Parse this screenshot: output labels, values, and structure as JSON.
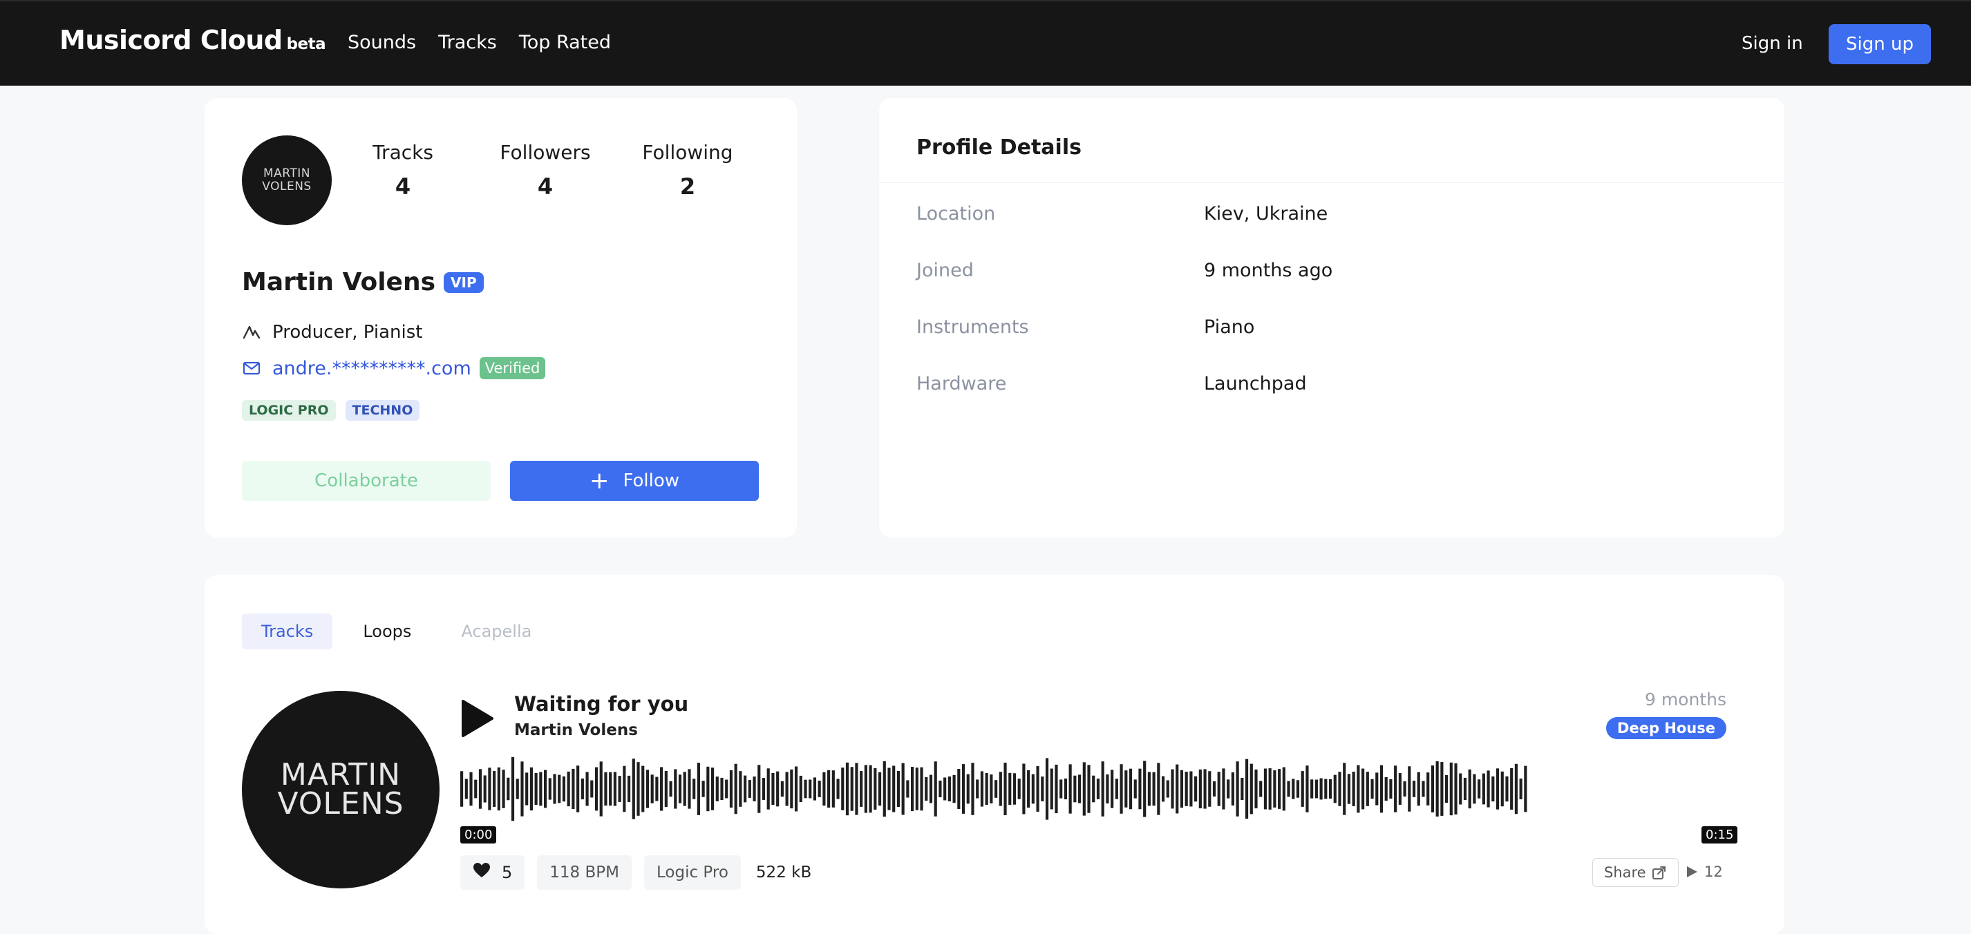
{
  "navbar": {
    "brand": "Musicord Cloud",
    "beta": "beta",
    "links": [
      "Sounds",
      "Tracks",
      "Top Rated"
    ],
    "sign_in": "Sign in",
    "sign_up": "Sign up"
  },
  "profile": {
    "avatar_line1": "MARTIN",
    "avatar_line2": "VOLENS",
    "stats": [
      {
        "label": "Tracks",
        "value": "4"
      },
      {
        "label": "Followers",
        "value": "4"
      },
      {
        "label": "Following",
        "value": "2"
      }
    ],
    "name": "Martin Volens",
    "vip_badge": "VIP",
    "role": "Producer, Pianist",
    "role_icon": "producer-icon",
    "email": "andre.**********.com",
    "email_icon": "mail-icon",
    "verified_badge": "Verified",
    "tags": [
      "LOGIC PRO",
      "TECHNO"
    ],
    "collaborate_label": "Collaborate",
    "follow_label": "Follow"
  },
  "details": {
    "title": "Profile Details",
    "rows": [
      {
        "label": "Location",
        "value": "Kiev, Ukraine"
      },
      {
        "label": "Joined",
        "value": "9 months ago"
      },
      {
        "label": "Instruments",
        "value": "Piano"
      },
      {
        "label": "Hardware",
        "value": "Launchpad"
      }
    ]
  },
  "tracks_section": {
    "tabs": [
      {
        "label": "Tracks",
        "state": "active"
      },
      {
        "label": "Loops",
        "state": "normal"
      },
      {
        "label": "Acapella",
        "state": "disabled"
      }
    ],
    "track": {
      "cover_line1": "MARTIN",
      "cover_line2": "VOLENS",
      "title": "Waiting for you",
      "artist": "Martin Volens",
      "age": "9 months",
      "genre": "Deep House",
      "time_start": "0:00",
      "time_end": "0:15",
      "likes": "5",
      "bpm": "118 BPM",
      "daw": "Logic Pro",
      "size": "522 kB",
      "share_label": "Share",
      "plays": "12"
    }
  },
  "colors": {
    "accent": "#3e6ef0",
    "navbar_bg": "#161616",
    "verified": "#6cc28c"
  }
}
